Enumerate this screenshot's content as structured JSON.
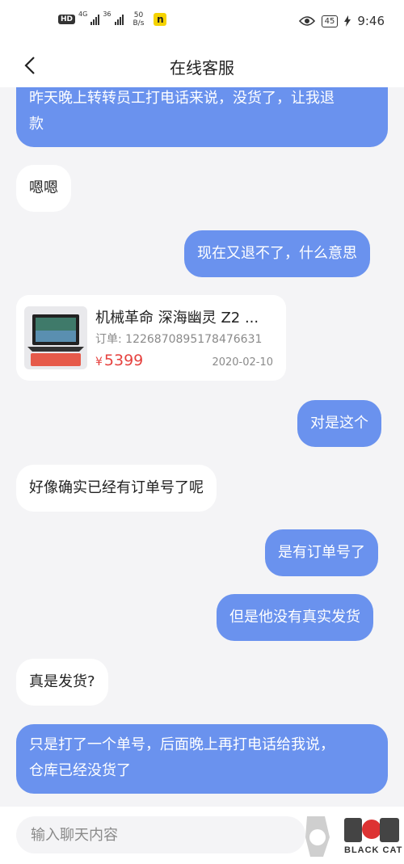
{
  "status_bar": {
    "hd": "HD",
    "net1": "4G",
    "net2": "36",
    "speed_value": "50",
    "speed_unit": "B/s",
    "app_badge": "n",
    "battery": "45",
    "time": "9:46"
  },
  "header": {
    "title": "在线客服"
  },
  "messages": [
    {
      "side": "out",
      "text_line1": "昨天晚上转转员工打电话来说，没货了，让我退",
      "text_line2": "款"
    },
    {
      "side": "in",
      "text": "嗯嗯"
    },
    {
      "side": "out",
      "text": "现在又退不了，什么意思"
    },
    {
      "side": "out",
      "text": "对是这个"
    },
    {
      "side": "in",
      "text": "好像确实已经有订单号了呢"
    },
    {
      "side": "out",
      "text": "是有订单号了"
    },
    {
      "side": "out",
      "text": "但是他没有真实发货"
    },
    {
      "side": "in",
      "text": "真是发货?"
    },
    {
      "side": "out",
      "text_line1": "只是打了一个单号，后面晚上再打电话给我说，",
      "text_line2": "仓库已经没货了"
    }
  ],
  "order_card": {
    "title": "机械革命 深海幽灵 Z2 ...",
    "order_label": "订单: 1226870895178476631",
    "currency": "¥",
    "price": "5399",
    "date": "2020-02-10"
  },
  "input_bar": {
    "placeholder": "输入聊天内容"
  },
  "watermark": {
    "label": "BLACK CAT"
  },
  "colors": {
    "outgoing_bubble": "#6a92ee",
    "price": "#e64340",
    "background": "#f4f4f6"
  }
}
